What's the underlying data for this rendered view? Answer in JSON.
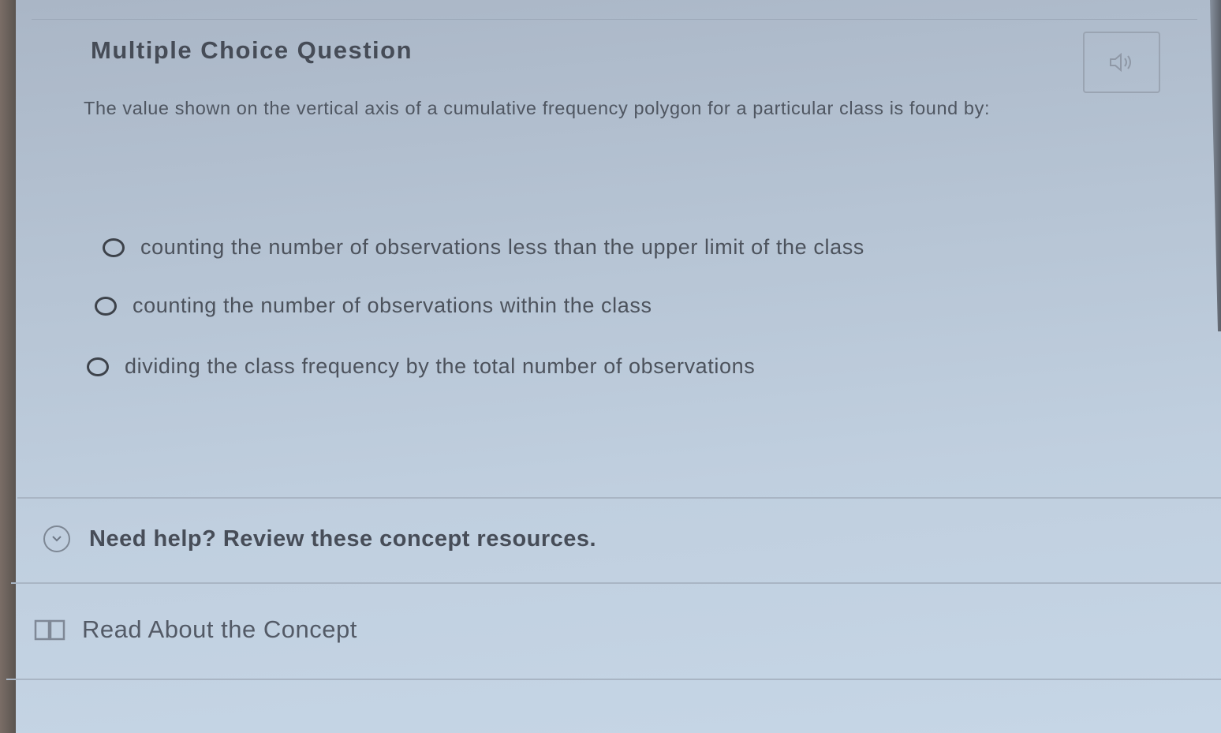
{
  "question": {
    "type_label": "Multiple Choice Question",
    "prompt": "The value shown on the vertical axis of a cumulative frequency polygon for a particular class is found by:",
    "audio_icon": "speaker-icon"
  },
  "options": [
    {
      "label": "counting the number of observations less than the upper limit of the class",
      "selected": false
    },
    {
      "label": "counting the number of observations within the class",
      "selected": false
    },
    {
      "label": "dividing the class frequency by the total number of observations",
      "selected": false
    }
  ],
  "help": {
    "toggle_label": "Need help? Review these concept resources.",
    "toggle_icon": "chevron-down-icon",
    "resources": [
      {
        "label": "Read About the Concept",
        "icon": "book-icon"
      }
    ]
  }
}
